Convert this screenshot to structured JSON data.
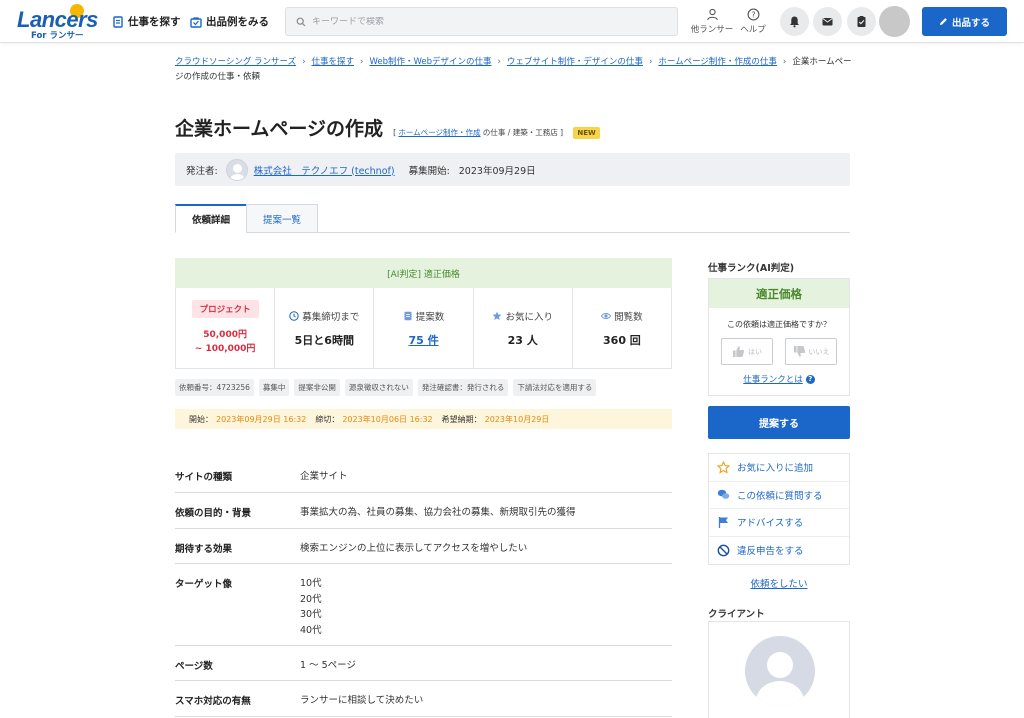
{
  "header": {
    "logo": "Lancers",
    "logo_sub": "For ランサー",
    "nav_find_job": "仕事を探す",
    "nav_examples": "出品例をみる",
    "search_placeholder": "キーワードで検索",
    "other_lancers": "他ランサー",
    "help": "ヘルプ",
    "post_button": "出品する"
  },
  "breadcrumb": [
    "クラウドソーシング ランサーズ",
    "仕事を探す",
    "Web制作・Webデザインの仕事",
    "ウェブサイト制作・デザインの仕事",
    "ホームページ制作・作成の仕事"
  ],
  "breadcrumb_current": "企業ホームページの作成の仕事・依頼",
  "job": {
    "title": "企業ホームページの作成",
    "meta_bracket_open": "[",
    "meta_category": "ホームページ制作・作成",
    "meta_rest": "の仕事 / 建築・工務店",
    "meta_bracket_close": "]",
    "new_badge": "NEW",
    "owner_label": "発注者:",
    "owner_name": "株式会社　テクノエフ (technof)",
    "start_label": "募集開始:",
    "start_date": "2023年09月29日"
  },
  "tabs": {
    "detail": "依頼詳細",
    "proposals": "提案一覧"
  },
  "ai_judgement": "[AI判定] 適正価格",
  "stats": {
    "project_badge": "プロジェクト",
    "price_min": "50,000円",
    "price_max": "~ 100,000円",
    "deadline_label": "募集締切まで",
    "deadline_value": "5日と6時間",
    "proposals_label": "提案数",
    "proposals_value": "75 件",
    "favorites_label": "お気に入り",
    "favorites_value": "23 人",
    "views_label": "閲覧数",
    "views_value": "360 回"
  },
  "tags": [
    "依頼番号：4723256",
    "募集中",
    "提案非公開",
    "源泉徴収されない",
    "発注確認書：発行される",
    "下請法対応を適用する"
  ],
  "dates": {
    "start_label": "開始：",
    "start_value": "2023年09月29日 16:32",
    "end_label": "締切：",
    "end_value": "2023年10月06日 16:32",
    "delivery_label": "希望納期：",
    "delivery_value": "2023年10月29日"
  },
  "details": [
    {
      "label": "サイトの種類",
      "value": "企業サイト"
    },
    {
      "label": "依頼の目的・背景",
      "value": "事業拡大の為、社員の募集、協力会社の募集、新規取引先の獲得"
    },
    {
      "label": "期待する効果",
      "value": "検索エンジンの上位に表示してアクセスを増やしたい"
    },
    {
      "label": "ターゲット像",
      "value": "10代\n20代\n30代\n40代"
    },
    {
      "label": "ページ数",
      "value": "1 ～ 5ページ"
    },
    {
      "label": "スマホ対応の有無",
      "value": "ランサーに相談して決めたい"
    }
  ],
  "sidebar": {
    "rank_title": "仕事ランク(AI判定)",
    "rank_value": "適正価格",
    "rank_question": "この依頼は適正価格ですか？",
    "yes": "はい",
    "no": "いいえ",
    "rank_link": "仕事ランクとは",
    "propose_button": "提案する",
    "actions": [
      "お気に入りに追加",
      "この依頼に質問する",
      "アドバイスする",
      "違反申告をする"
    ],
    "request_link": "依頼をしたい",
    "client_title": "クライアント"
  },
  "colors": {
    "primary": "#1a66c9",
    "link": "#1d67c7",
    "ai_green_bg": "#e5f3de",
    "ai_green_text": "#4a8a2e",
    "price_red": "#d92c3f",
    "date_orange": "#e48a12"
  }
}
